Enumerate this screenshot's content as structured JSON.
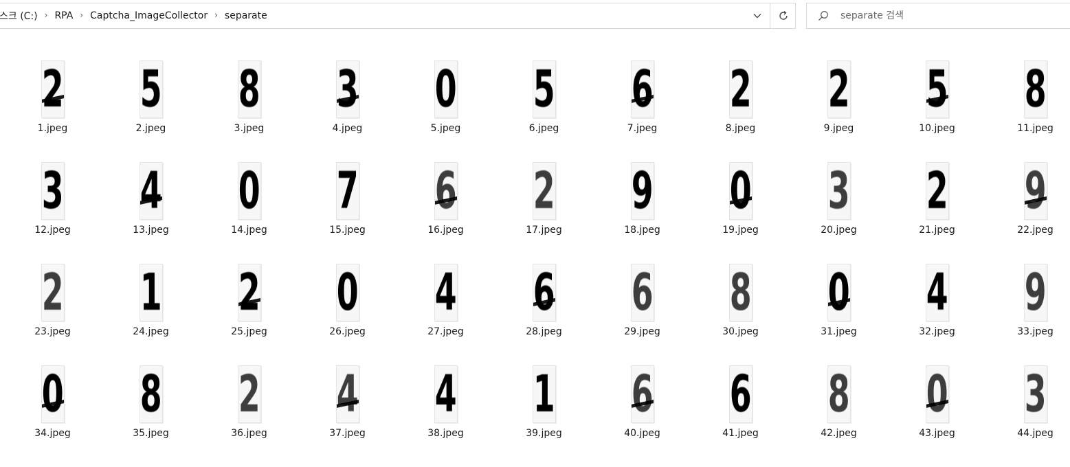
{
  "breadcrumb": {
    "items": [
      "스크 (C:)",
      "RPA",
      "Captcha_ImageCollector",
      "separate"
    ]
  },
  "search": {
    "placeholder": "separate 검색"
  },
  "files": [
    {
      "name": "1.jpeg",
      "glyph": "2"
    },
    {
      "name": "2.jpeg",
      "glyph": "5"
    },
    {
      "name": "3.jpeg",
      "glyph": "8"
    },
    {
      "name": "4.jpeg",
      "glyph": "3"
    },
    {
      "name": "5.jpeg",
      "glyph": "0"
    },
    {
      "name": "6.jpeg",
      "glyph": "5"
    },
    {
      "name": "7.jpeg",
      "glyph": "6"
    },
    {
      "name": "8.jpeg",
      "glyph": "2"
    },
    {
      "name": "9.jpeg",
      "glyph": "2"
    },
    {
      "name": "10.jpeg",
      "glyph": "5"
    },
    {
      "name": "11.jpeg",
      "glyph": "8"
    },
    {
      "name": "12.jpeg",
      "glyph": "3"
    },
    {
      "name": "13.jpeg",
      "glyph": "4"
    },
    {
      "name": "14.jpeg",
      "glyph": "0"
    },
    {
      "name": "15.jpeg",
      "glyph": "7"
    },
    {
      "name": "16.jpeg",
      "glyph": "6"
    },
    {
      "name": "17.jpeg",
      "glyph": "2"
    },
    {
      "name": "18.jpeg",
      "glyph": "9"
    },
    {
      "name": "19.jpeg",
      "glyph": "0"
    },
    {
      "name": "20.jpeg",
      "glyph": "3"
    },
    {
      "name": "21.jpeg",
      "glyph": "2"
    },
    {
      "name": "22.jpeg",
      "glyph": "9"
    },
    {
      "name": "23.jpeg",
      "glyph": "2"
    },
    {
      "name": "24.jpeg",
      "glyph": "1"
    },
    {
      "name": "25.jpeg",
      "glyph": "2"
    },
    {
      "name": "26.jpeg",
      "glyph": "0"
    },
    {
      "name": "27.jpeg",
      "glyph": "4"
    },
    {
      "name": "28.jpeg",
      "glyph": "6"
    },
    {
      "name": "29.jpeg",
      "glyph": "6"
    },
    {
      "name": "30.jpeg",
      "glyph": "8"
    },
    {
      "name": "31.jpeg",
      "glyph": "0"
    },
    {
      "name": "32.jpeg",
      "glyph": "4"
    },
    {
      "name": "33.jpeg",
      "glyph": "9"
    },
    {
      "name": "34.jpeg",
      "glyph": "0"
    },
    {
      "name": "35.jpeg",
      "glyph": "8"
    },
    {
      "name": "36.jpeg",
      "glyph": "2"
    },
    {
      "name": "37.jpeg",
      "glyph": "4"
    },
    {
      "name": "38.jpeg",
      "glyph": "4"
    },
    {
      "name": "39.jpeg",
      "glyph": "1"
    },
    {
      "name": "40.jpeg",
      "glyph": "6"
    },
    {
      "name": "41.jpeg",
      "glyph": "6"
    },
    {
      "name": "42.jpeg",
      "glyph": "8"
    },
    {
      "name": "43.jpeg",
      "glyph": "0"
    },
    {
      "name": "44.jpeg",
      "glyph": "3"
    }
  ]
}
